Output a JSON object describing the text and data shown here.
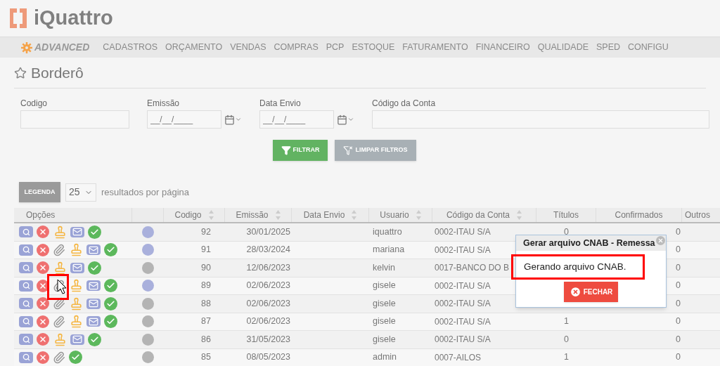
{
  "brand": {
    "name": "iQuattro",
    "edition": "ADVANCED"
  },
  "menu": [
    "CADASTROS",
    "ORÇAMENTO",
    "VENDAS",
    "COMPRAS",
    "PCP",
    "ESTOQUE",
    "FATURAMENTO",
    "FINANCEIRO",
    "QUALIDADE",
    "SPED",
    "CONFIGU"
  ],
  "page_title": "Borderô",
  "filters": [
    {
      "label": "Codigo",
      "kind": "text"
    },
    {
      "label": "Emissão",
      "kind": "date",
      "placeholder": "__/__/____"
    },
    {
      "label": "Data Envio",
      "kind": "date",
      "placeholder": "__/__/____"
    },
    {
      "label": "Código da Conta",
      "kind": "wide"
    }
  ],
  "filter_buttons": [
    {
      "label": "FILTRAR",
      "kind": "filter"
    },
    {
      "label": "LIMPAR FILTROS",
      "kind": "clear"
    }
  ],
  "legend_button": "LEGENDA",
  "page_size": {
    "value": "25",
    "label": "resultados por página"
  },
  "table": {
    "columns": [
      {
        "label": "Opções",
        "sortable": false
      },
      {
        "sortable": false
      },
      {
        "label": "Codigo",
        "sortable": true
      },
      {
        "label": "Emissão",
        "sortable": true
      },
      {
        "label": "Data Envio",
        "sortable": true
      },
      {
        "label": "Usuario",
        "sortable": true
      },
      {
        "label": "Código da Conta",
        "sortable": true
      },
      {
        "label": "Títulos",
        "sortable": false
      },
      {
        "label": "Confirmados",
        "sortable": false
      },
      {
        "label": "Outros",
        "sortable": false
      }
    ],
    "rows": [
      {
        "actions": [
          {
            "kind": "view"
          },
          {
            "kind": "cancel"
          },
          {
            "kind": "stamp"
          },
          {
            "kind": "mail"
          },
          {
            "kind": "confirm"
          }
        ],
        "color": "#a9b0dc",
        "codigo": "92",
        "emissao": "30/01/2025",
        "usuario": "iquattro",
        "conta": "0002-ITAU S/A",
        "titulos": "0",
        "confirmados": "0"
      },
      {
        "actions": [
          {
            "kind": "view"
          },
          {
            "kind": "cancel"
          },
          {
            "kind": "attach"
          },
          {
            "kind": "stamp"
          },
          {
            "kind": "mail"
          },
          {
            "kind": "confirm"
          }
        ],
        "color": "#a9b0dc",
        "codigo": "91",
        "emissao": "28/03/2024",
        "usuario": "mariana",
        "conta": "0002-ITAU S/A",
        "confirmados": "0"
      },
      {
        "actions": [
          {
            "kind": "view"
          },
          {
            "kind": "cancel"
          },
          {
            "kind": "stamp"
          },
          {
            "kind": "mail"
          },
          {
            "kind": "confirm"
          }
        ],
        "color": "#b4b4b4",
        "codigo": "90",
        "emissao": "12/06/2023",
        "usuario": "kelvin",
        "conta": "0017-BANCO DO B",
        "confirmados": "0"
      },
      {
        "actions": [
          {
            "kind": "view"
          },
          {
            "kind": "cancel"
          },
          {
            "kind": "attach"
          },
          {
            "kind": "stamp"
          },
          {
            "kind": "mail"
          },
          {
            "kind": "confirm"
          }
        ],
        "color": "#a9b0dc",
        "codigo": "89",
        "emissao": "02/06/2023",
        "usuario": "gisele",
        "conta": "0002-ITAU S/A",
        "confirmados": "0"
      },
      {
        "actions": [
          {
            "kind": "view"
          },
          {
            "kind": "cancel"
          },
          {
            "kind": "attach"
          },
          {
            "kind": "stamp"
          },
          {
            "kind": "mail"
          },
          {
            "kind": "confirm"
          }
        ],
        "color": "#b4b4b4",
        "codigo": "88",
        "emissao": "02/06/2023",
        "usuario": "gisele",
        "conta": "0002-ITAU S/A",
        "confirmados": "0"
      },
      {
        "actions": [
          {
            "kind": "view"
          },
          {
            "kind": "cancel"
          },
          {
            "kind": "attach"
          },
          {
            "kind": "stamp"
          },
          {
            "kind": "mail"
          },
          {
            "kind": "confirm"
          }
        ],
        "color": "#b4b4b4",
        "codigo": "87",
        "emissao": "02/06/2023",
        "usuario": "gisele",
        "conta": "0002-ITAU S/A",
        "titulos": "1",
        "confirmados": "0"
      },
      {
        "actions": [
          {
            "kind": "view"
          },
          {
            "kind": "cancel"
          },
          {
            "kind": "stamp"
          },
          {
            "kind": "mail"
          },
          {
            "kind": "confirm"
          }
        ],
        "color": "#b4b4b4",
        "codigo": "86",
        "emissao": "31/05/2023",
        "usuario": "gisele",
        "conta": "0002-ITAU S/A",
        "titulos": "0",
        "confirmados": "0"
      },
      {
        "actions": [
          {
            "kind": "view"
          },
          {
            "kind": "cancel"
          },
          {
            "kind": "attach"
          },
          {
            "kind": "confirm"
          }
        ],
        "color": "#b4b4b4",
        "codigo": "85",
        "emissao": "08/05/2023",
        "usuario": "admin",
        "conta": "0007-AILOS",
        "titulos": "1",
        "confirmados": "0"
      }
    ]
  },
  "dialog": {
    "title": "Gerar arquivo CNAB - Remessa",
    "message": "Gerando arquivo CNAB.",
    "button": "FECHAR"
  }
}
